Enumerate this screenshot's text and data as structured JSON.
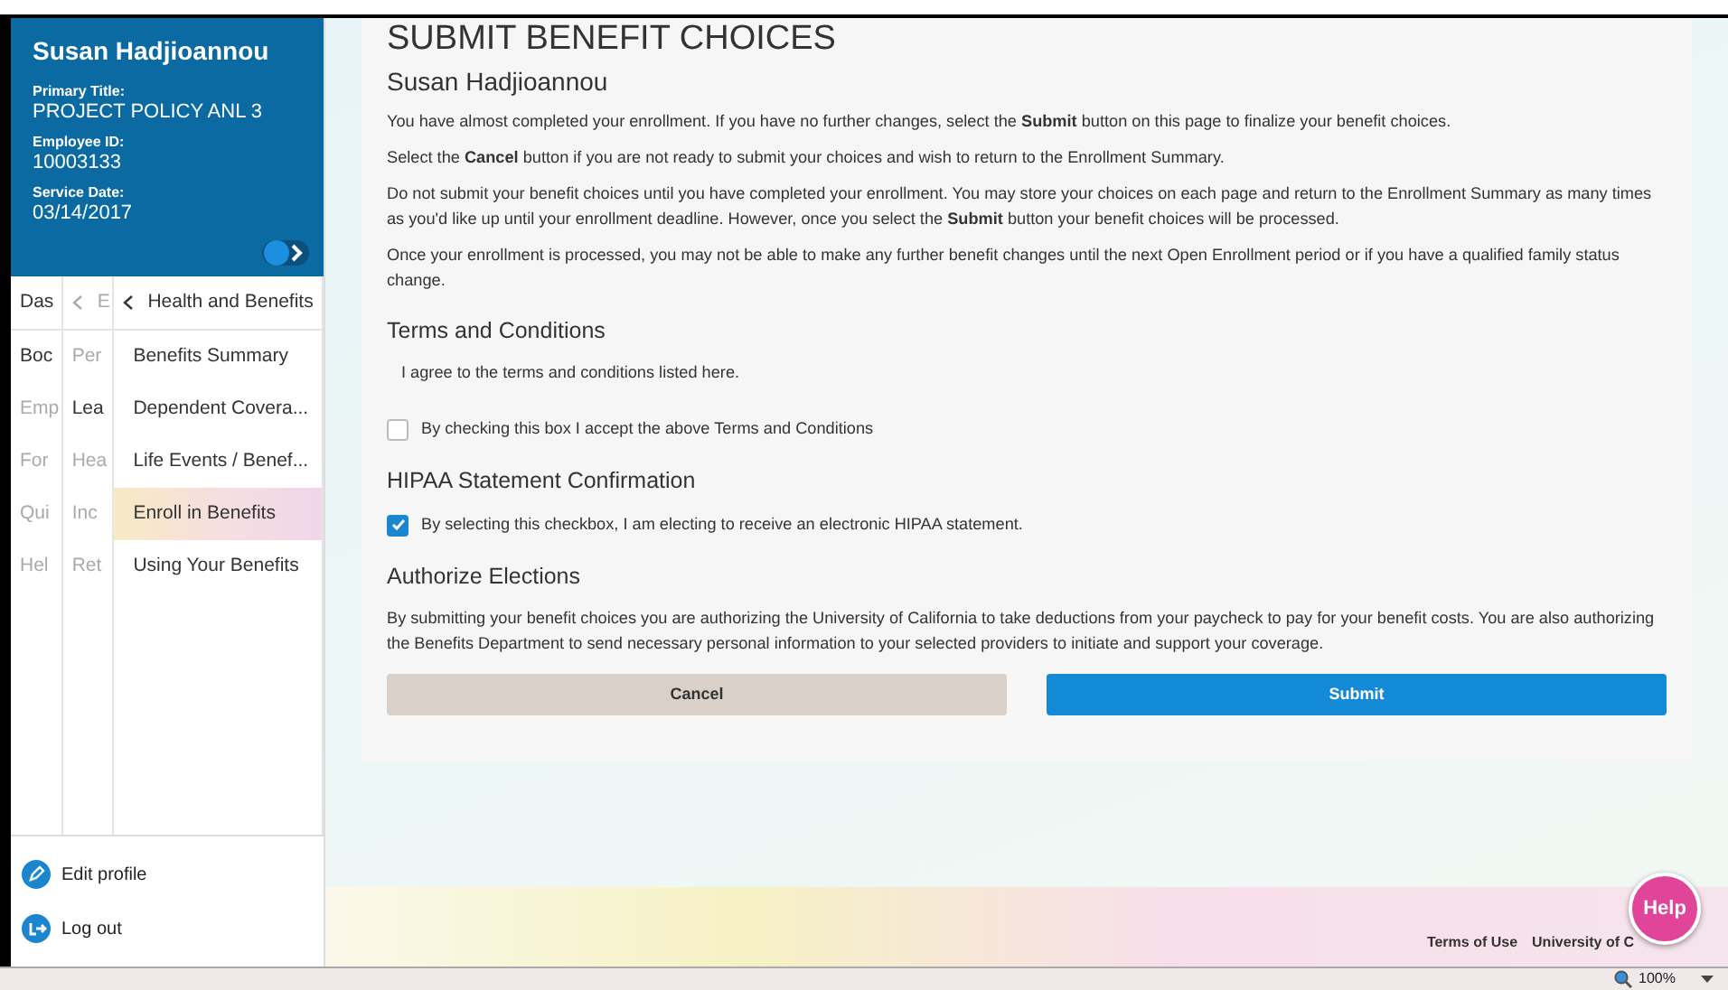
{
  "profile": {
    "name": "Susan Hadjioannou",
    "fields": [
      {
        "label": "Primary Title:",
        "value": "PROJECT POLICY ANL 3"
      },
      {
        "label": "Employee ID:",
        "value": "10003133"
      },
      {
        "label": "Service Date:",
        "value": "03/14/2017"
      }
    ]
  },
  "nav_columns": [
    {
      "items": [
        {
          "label": "Das",
          "dimmed": false
        },
        {
          "label": "Boc",
          "dimmed": false
        },
        {
          "label": "Emp",
          "dimmed": true
        },
        {
          "label": "For",
          "dimmed": true
        },
        {
          "label": "Qui",
          "dimmed": true
        },
        {
          "label": "Hel",
          "dimmed": true
        }
      ]
    },
    {
      "back": "E",
      "items": [
        {
          "label": "Per",
          "dimmed": true
        },
        {
          "label": "Lea",
          "dimmed": false
        },
        {
          "label": "Hea",
          "dimmed": true
        },
        {
          "label": "Inc",
          "dimmed": true
        },
        {
          "label": "Ret",
          "dimmed": true
        }
      ]
    },
    {
      "back": "Health and Benefits",
      "items": [
        {
          "label": "Benefits Summary",
          "selected": false
        },
        {
          "label": "Dependent Covera...",
          "selected": false
        },
        {
          "label": "Life Events / Benef...",
          "selected": false
        },
        {
          "label": "Enroll in Benefits",
          "selected": true
        },
        {
          "label": "Using Your Benefits",
          "selected": false
        }
      ]
    }
  ],
  "account_links": [
    {
      "kind": "edit",
      "label": "Edit profile"
    },
    {
      "kind": "logout",
      "label": "Log out"
    }
  ],
  "page_title": "SUBMIT BENEFIT CHOICES",
  "employee_name": "Susan Hadjioannou",
  "intro": [
    "You have almost completed your enrollment. If you have no further changes, select the **Submit** button on this page to finalize your benefit choices.",
    "Select the **Cancel** button if you are not ready to submit your choices and wish to return to the Enrollment Summary.",
    "Do not submit your benefit choices until you have completed your enrollment. You may store your choices on each page and return to the Enrollment Summary as many times as you'd like up until your enrollment deadline. However, once you select the **Submit** button your benefit choices will be processed.",
    "Once your enrollment is processed, you may not be able to make any further benefit changes until the next Open Enrollment period or if you have a qualified family status change."
  ],
  "sections": [
    {
      "kind": "terms",
      "heading": "Terms and Conditions",
      "text": "I agree to the terms and conditions listed here.",
      "checkbox": {
        "label": "By checking this box I accept the above Terms and Conditions",
        "checked": false
      }
    },
    {
      "kind": "check",
      "heading": "HIPAA Statement Confirmation",
      "checkbox": {
        "label": "By selecting this checkbox, I am electing to receive an electronic HIPAA statement.",
        "checked": true
      }
    },
    {
      "kind": "text",
      "heading": "Authorize Elections",
      "text": "By submitting your benefit choices you are authorizing the University of California to take deductions from your paycheck to pay for your benefit costs. You are also authorizing the Benefits Department to send necessary personal information to your selected providers to initiate and support your coverage."
    }
  ],
  "buttons": [
    {
      "kind": "secondary",
      "label": "Cancel"
    },
    {
      "kind": "primary",
      "label": "Submit"
    }
  ],
  "footer_links": [
    "Terms of Use",
    "University of C"
  ],
  "help_button": "Help",
  "status_bar": {
    "zoom": "100%"
  }
}
